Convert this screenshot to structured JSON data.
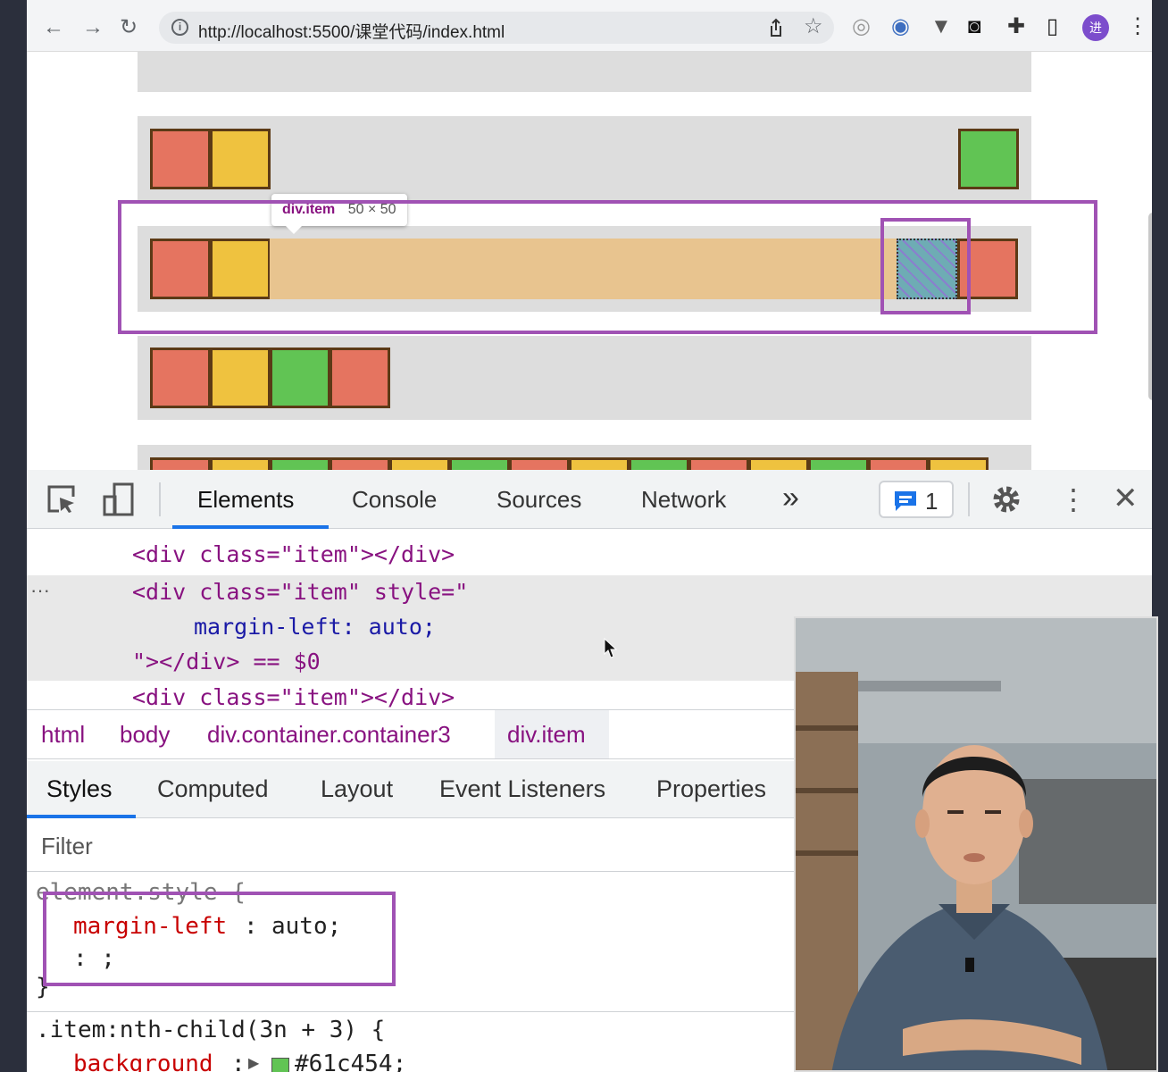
{
  "browser": {
    "url": "http://localhost:5500/课堂代码/index.html",
    "avatar_letter": "进",
    "icons": [
      "back-icon",
      "forward-icon",
      "reload-icon",
      "info-icon",
      "share-icon",
      "star-icon",
      "extension-icons",
      "puzzle-icon",
      "sidebar-icon",
      "menu-icon"
    ]
  },
  "tooltip": {
    "tag": "div.item",
    "size": "50 × 50"
  },
  "devtools": {
    "tabs": [
      "Elements",
      "Console",
      "Sources",
      "Network"
    ],
    "more": "»",
    "issues_count": "1",
    "dom": {
      "line1": "<div class=\"item\"></div>",
      "line2_open": "<div class=\"item\" style=\"",
      "line3": "margin-left: auto;",
      "line4": "\"></div> == $0",
      "line5": "<div class=\"item\"></div>",
      "ellipsis": "···"
    },
    "breadcrumb": [
      "html",
      "body",
      "div.container.container3",
      "div.item"
    ],
    "style_tabs": [
      "Styles",
      "Computed",
      "Layout",
      "Event Listeners",
      "Properties"
    ],
    "filter_placeholder": "Filter",
    "rules": {
      "element_style": "element.style {",
      "prop1_name": "margin-left",
      "prop1_value": "auto;",
      "prop2": ": ;",
      "close": "}",
      "rule2_selector": ".item:nth-child(3n + 3) {",
      "rule2_prop": "background",
      "rule2_value": "#61c454;"
    }
  },
  "colors": {
    "red": "#e57460",
    "yellow": "#efc23f",
    "green": "#61c454",
    "margin_fill": "#e8c48f",
    "highlight": "#a052b4"
  }
}
